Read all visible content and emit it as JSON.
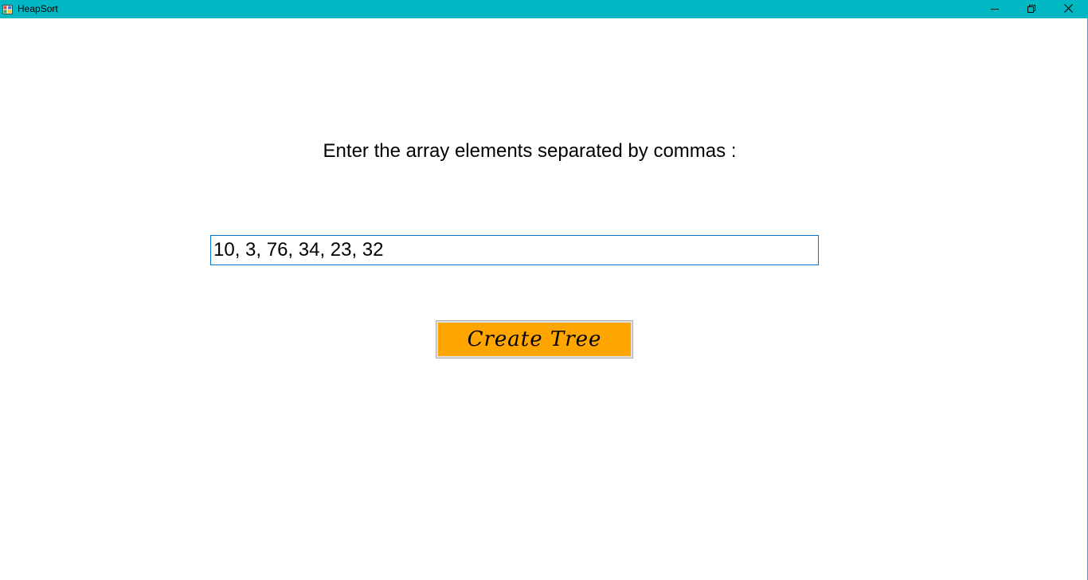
{
  "window": {
    "title": "HeapSort",
    "titlebar_color": "#00b7c3"
  },
  "form": {
    "prompt": "Enter the array elements separated by commas :",
    "array_value": "10, 3, 76, 34, 23, 32",
    "create_button_label": "Create Tree",
    "button_color": "#ffa500"
  },
  "icons": {
    "app": "app-icon",
    "minimize": "minimize-icon",
    "restore": "restore-icon",
    "close": "close-icon"
  }
}
